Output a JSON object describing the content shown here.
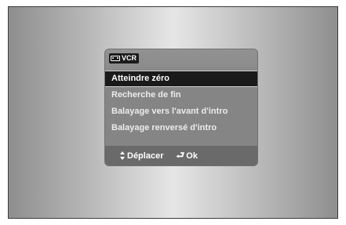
{
  "menu": {
    "source_label": "VCR",
    "items": [
      {
        "label": "Atteindre zéro",
        "selected": true
      },
      {
        "label": "Recherche de fin",
        "selected": false
      },
      {
        "label": "Balayage vers l'avant d'intro",
        "selected": false
      },
      {
        "label": "Balayage renversé d'intro",
        "selected": false
      }
    ]
  },
  "footer": {
    "move_icon": "up-down-arrows-icon",
    "move_label": "Déplacer",
    "ok_icon": "enter-icon",
    "ok_label": "Ok"
  },
  "colors": {
    "highlight": "#1a1a1a",
    "menu_bg": "#858585",
    "footer_bg": "#6a6a6a"
  }
}
